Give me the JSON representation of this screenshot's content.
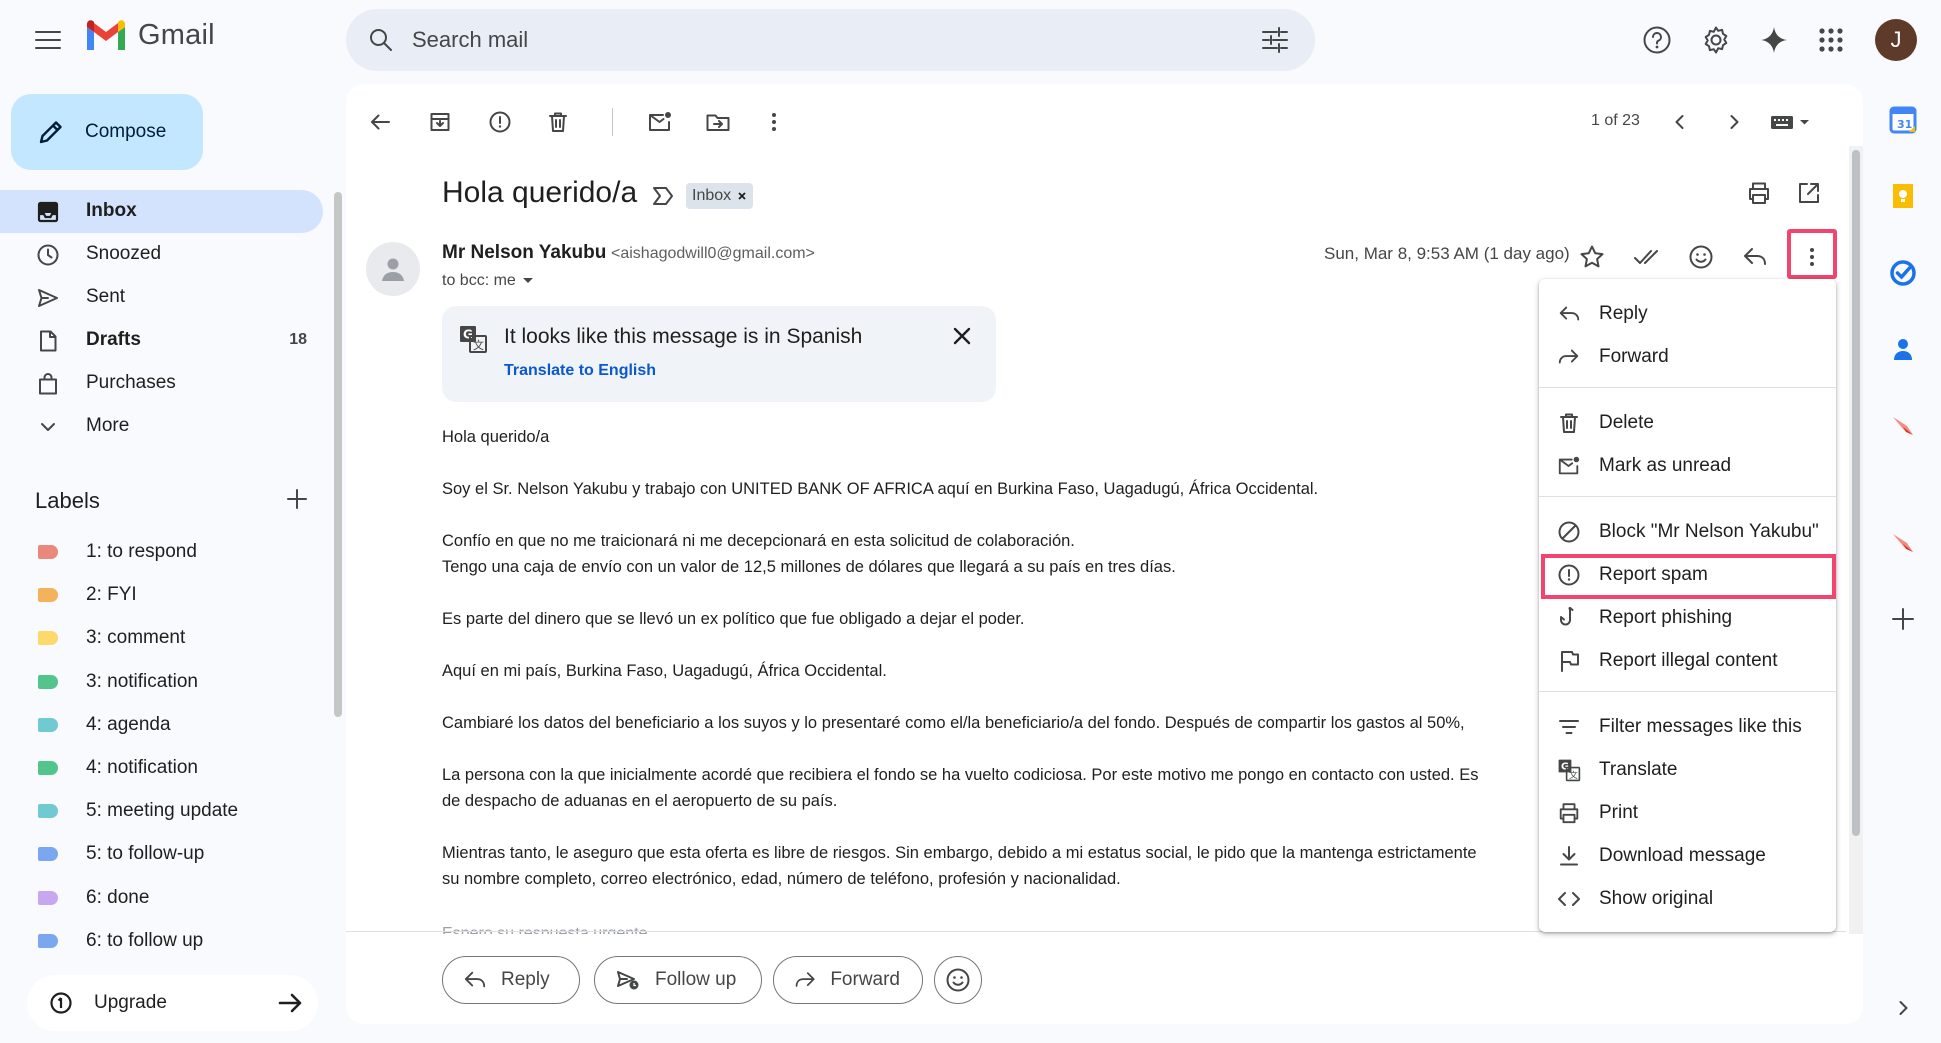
{
  "app": {
    "name": "Gmail",
    "avatar_initial": "J"
  },
  "search": {
    "placeholder": "Search mail"
  },
  "sidebar": {
    "compose_label": "Compose",
    "nav": [
      {
        "label": "Inbox",
        "icon": "inbox-icon",
        "count": ""
      },
      {
        "label": "Snoozed",
        "icon": "clock-icon",
        "count": ""
      },
      {
        "label": "Sent",
        "icon": "send-icon",
        "count": ""
      },
      {
        "label": "Drafts",
        "icon": "draft-icon",
        "count": "18"
      },
      {
        "label": "Purchases",
        "icon": "shopping-bag-icon",
        "count": ""
      },
      {
        "label": "More",
        "icon": "chevron-down-icon",
        "count": ""
      }
    ],
    "labels_heading": "Labels",
    "labels": [
      {
        "label": "1: to respond",
        "color": "#e8897b"
      },
      {
        "label": "2: FYI",
        "color": "#f4b25c"
      },
      {
        "label": "3: comment",
        "color": "#fbd96a"
      },
      {
        "label": "3: notification",
        "color": "#52c48c"
      },
      {
        "label": "4: agenda",
        "color": "#6fcbd1"
      },
      {
        "label": "4: notification",
        "color": "#52c48c"
      },
      {
        "label": "5: meeting update",
        "color": "#6fcbd1"
      },
      {
        "label": "5: to follow-up",
        "color": "#7aa7ef"
      },
      {
        "label": "6: done",
        "color": "#c7a7ef"
      },
      {
        "label": "6: to follow up",
        "color": "#7aa7ef"
      }
    ],
    "upgrade_label": "Upgrade"
  },
  "toolbar": {
    "pager": "1 of 23"
  },
  "message": {
    "subject": "Hola querido/a",
    "label_chip": "Inbox",
    "sender_name": "Mr Nelson Yakubu",
    "sender_email": "<aishagodwill0@gmail.com>",
    "to_line": "to bcc: me",
    "date": "Sun, Mar 8, 9:53 AM (1 day ago)",
    "translate_notice": "It looks like this message is in Spanish",
    "translate_link": "Translate to English",
    "body": [
      "Hola querido/a",
      "Soy el Sr. Nelson Yakubu y trabajo con UNITED BANK OF AFRICA aquí en Burkina Faso, Uagadugú, África Occidental.",
      "Confío en que no me traicionará ni me decepcionará en esta solicitud de colaboración.\nTengo una caja de envío con un valor de 12,5 millones de dólares que llegará a su país en tres días.",
      "Es parte del dinero que se llevó un ex político que fue obligado a dejar el poder.",
      "Aquí en mi país, Burkina Faso, Uagadugú, África Occidental.",
      "Cambiaré los datos del beneficiario a los suyos y lo presentaré como el/la beneficiario/a del fondo. Después de compartir los gastos al 50%,",
      "La persona con la que inicialmente acordé que recibiera el fondo se ha vuelto codiciosa. Por este motivo me pongo en contacto con usted. Es\nde despacho de aduanas en el aeropuerto de su país.",
      "Mientras tanto, le aseguro que esta oferta es libre de riesgos. Sin embargo, debido a mi estatus social, le pido que la mantenga estrictamente\nsu nombre completo, correo electrónico, edad, número de teléfono, profesión y nacionalidad."
    ],
    "body_cut": "Espero su respuesta urgente"
  },
  "reply_bar": {
    "reply": "Reply",
    "follow_up": "Follow up",
    "forward": "Forward"
  },
  "menu": {
    "items": [
      {
        "label": "Reply",
        "icon": "reply-icon"
      },
      {
        "label": "Forward",
        "icon": "forward-icon"
      },
      {
        "label": "Delete",
        "icon": "trash-icon"
      },
      {
        "label": "Mark as unread",
        "icon": "mark-unread-icon"
      },
      {
        "label": "Block \"Mr Nelson Yakubu\"",
        "icon": "block-icon"
      },
      {
        "label": "Report spam",
        "icon": "report-spam-icon"
      },
      {
        "label": "Report phishing",
        "icon": "phishing-hook-icon"
      },
      {
        "label": "Report illegal content",
        "icon": "flag-icon"
      },
      {
        "label": "Filter messages like this",
        "icon": "filter-icon"
      },
      {
        "label": "Translate",
        "icon": "translate-icon"
      },
      {
        "label": "Print",
        "icon": "print-icon"
      },
      {
        "label": "Download message",
        "icon": "download-icon"
      },
      {
        "label": "Show original",
        "icon": "code-icon"
      }
    ],
    "highlighted": "Report spam",
    "highlight_color": "#f2446e"
  }
}
